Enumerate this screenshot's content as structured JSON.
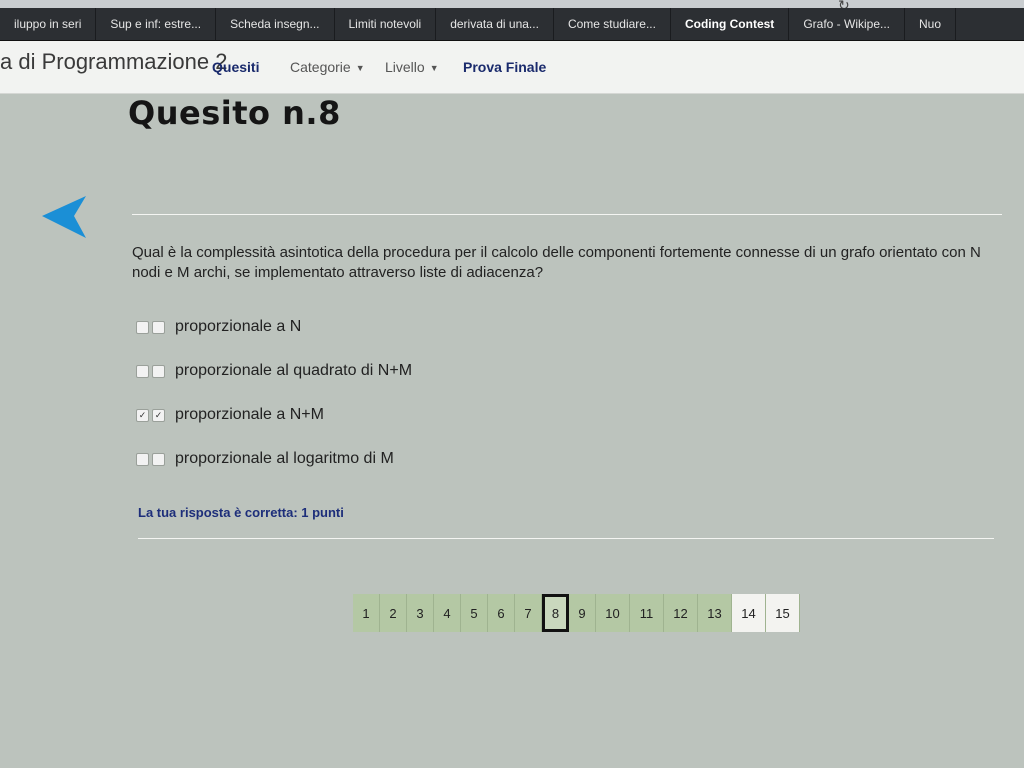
{
  "bookmarks": [
    {
      "label": "iluppo in seri"
    },
    {
      "label": "Sup e inf: estre..."
    },
    {
      "label": "Scheda insegn..."
    },
    {
      "label": "Limiti notevoli"
    },
    {
      "label": "derivata di una..."
    },
    {
      "label": "Come studiare..."
    },
    {
      "label": "Coding Contest"
    },
    {
      "label": "Grafo - Wikipe..."
    },
    {
      "label": "Nuo"
    }
  ],
  "navbar": {
    "site_title": "a di Programmazione 2",
    "quesiti": "Quesiti",
    "categorie": "Categorie",
    "livello": "Livello",
    "prova_finale": "Prova Finale"
  },
  "page": {
    "title": "Quesito n.8",
    "question": "Qual è la complessità asintotica della procedura per il calcolo delle componenti fortemente connesse di un grafo orientato con N nodi e M archi, se implementato attraverso liste di adiacenza?",
    "options": [
      {
        "label": "proporzionale a N",
        "checked": false
      },
      {
        "label": "proporzionale al quadrato di N+M",
        "checked": false
      },
      {
        "label": "proporzionale a N+M",
        "checked": true
      },
      {
        "label": "proporzionale al logaritmo di M",
        "checked": false
      }
    ],
    "feedback": "La tua risposta è corretta: 1 punti"
  },
  "pagination": {
    "pages": [
      "1",
      "2",
      "3",
      "4",
      "5",
      "6",
      "7",
      "8",
      "9",
      "10",
      "11",
      "12",
      "13",
      "14",
      "15"
    ],
    "current": "8",
    "unanswered": [
      "14",
      "15"
    ]
  },
  "colors": {
    "accent_arrow": "#1b8fd6",
    "answered": "#b4c8a4",
    "link_blue": "#1d2e7a"
  }
}
